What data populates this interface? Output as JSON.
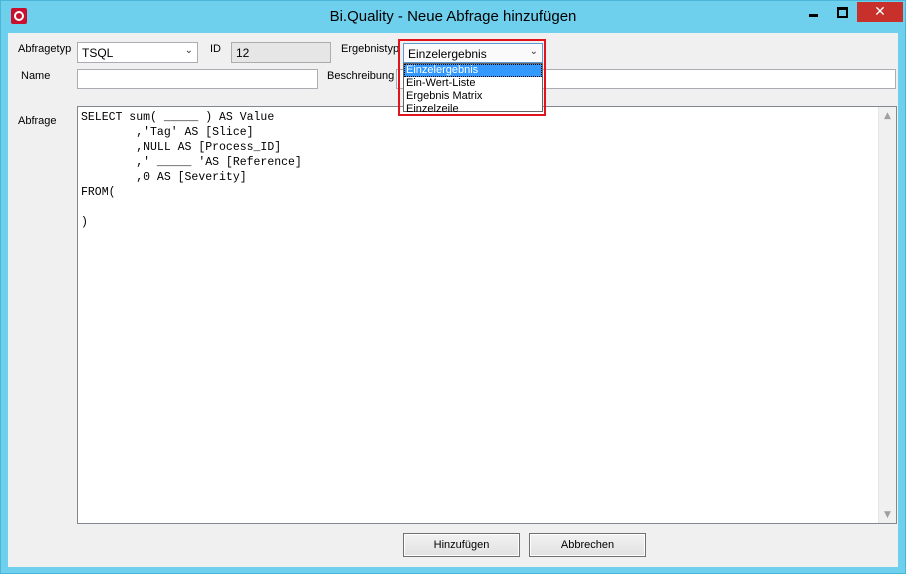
{
  "window": {
    "title": "Bi.Quality - Neue Abfrage hinzufügen",
    "close_glyph": "✕",
    "icons": {
      "app": "app-logo-icon",
      "minimize": "minimize-icon",
      "maximize": "maximize-icon",
      "close": "close-icon"
    }
  },
  "form": {
    "abfragetyp_label": "Abfragetyp",
    "abfragetyp_value": "TSQL",
    "id_label": "ID",
    "id_value": "12",
    "ergebnistyp_label": "Ergebnistyp",
    "ergebnistyp_value": "Einzelergebnis",
    "ergebnistyp_options": [
      "Einzelergebnis",
      "Ein-Wert-Liste",
      "Ergebnis Matrix",
      "Einzelzeile"
    ],
    "name_label": "Name",
    "name_value": "",
    "beschreibung_label": "Beschreibung",
    "beschreibung_value": "",
    "abfrage_label": "Abfrage",
    "abfrage_text": "SELECT sum( _____ ) AS Value\n        ,'Tag' AS [Slice]\n        ,NULL AS [Process_ID]\n        ,' _____ 'AS [Reference]\n        ,0 AS [Severity]\nFROM(\n\n)"
  },
  "buttons": {
    "add_label": "Hinzufügen",
    "cancel_label": "Abbrechen"
  },
  "dropdown_glyph": "⌄",
  "scroll_up_glyph": "▲",
  "scroll_down_glyph": "▼",
  "colors": {
    "titlebar": "#6fd0ee",
    "close_button": "#c7302b",
    "highlight": "#e0141e",
    "selection": "#3399ff"
  }
}
